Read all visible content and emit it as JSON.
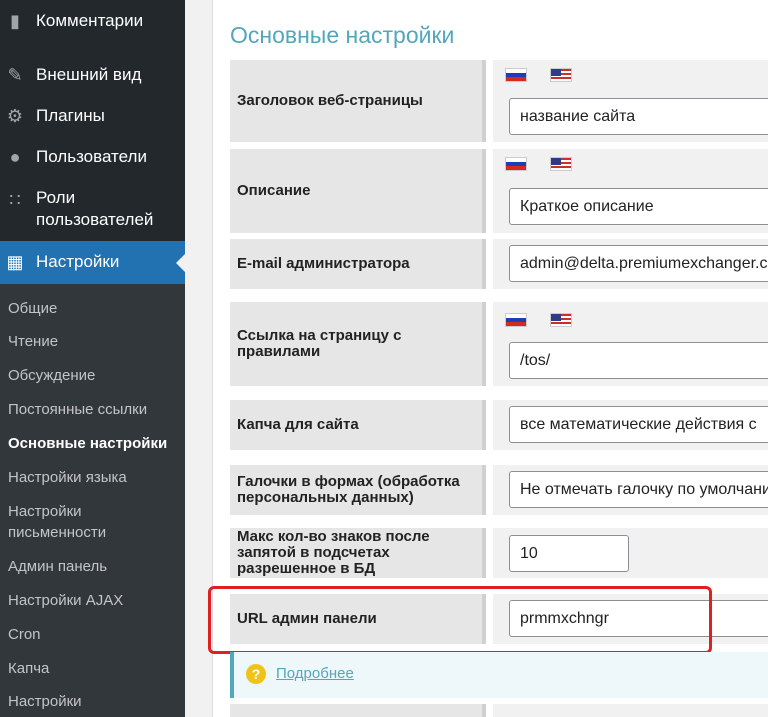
{
  "sidebar": {
    "menu": [
      {
        "label": "Комментарии",
        "icon": "comment-icon"
      },
      {
        "label": "Внешний вид",
        "icon": "brush-icon"
      },
      {
        "label": "Плагины",
        "icon": "plugin-icon"
      },
      {
        "label": "Пользователи",
        "icon": "user-icon"
      },
      {
        "label": "Роли пользователей",
        "icon": "users-group-icon"
      },
      {
        "label": "Настройки",
        "icon": "settings-icon"
      }
    ],
    "submenu": [
      "Общие",
      "Чтение",
      "Обсуждение",
      "Постоянные ссылки",
      "Основные настройки",
      "Настройки языка",
      "Настройки письменности",
      "Админ панель",
      "Настройки AJAX",
      "Cron",
      "Капча",
      "Настройки"
    ]
  },
  "page": {
    "title": "Основные настройки",
    "rows": [
      {
        "label": "Заголовок веб-страницы",
        "value": "название сайта"
      },
      {
        "label": "Описание",
        "value": "Краткое описание"
      },
      {
        "label": "E-mail администратора",
        "value": "admin@delta.premiumexchanger.com"
      },
      {
        "label": "Ссылка на страницу с правилами",
        "value": "/tos/"
      },
      {
        "label": "Капча для сайта",
        "value": "все математические действия с"
      },
      {
        "label": "Галочки в формах (обработка персональных данных)",
        "value": "Не отмечать галочку по умолчанию"
      },
      {
        "label": "Макс кол-во знаков после запятой в подсчетах разрешенное в БД",
        "value": "10"
      },
      {
        "label": "URL админ панели",
        "value": "prmmxchngr"
      }
    ],
    "help_link": "Подробнее",
    "help_icon": "question-icon"
  },
  "colors": {
    "accent": "#52a7bb",
    "menu_active": "#2271b1",
    "highlight": "#e02020"
  }
}
